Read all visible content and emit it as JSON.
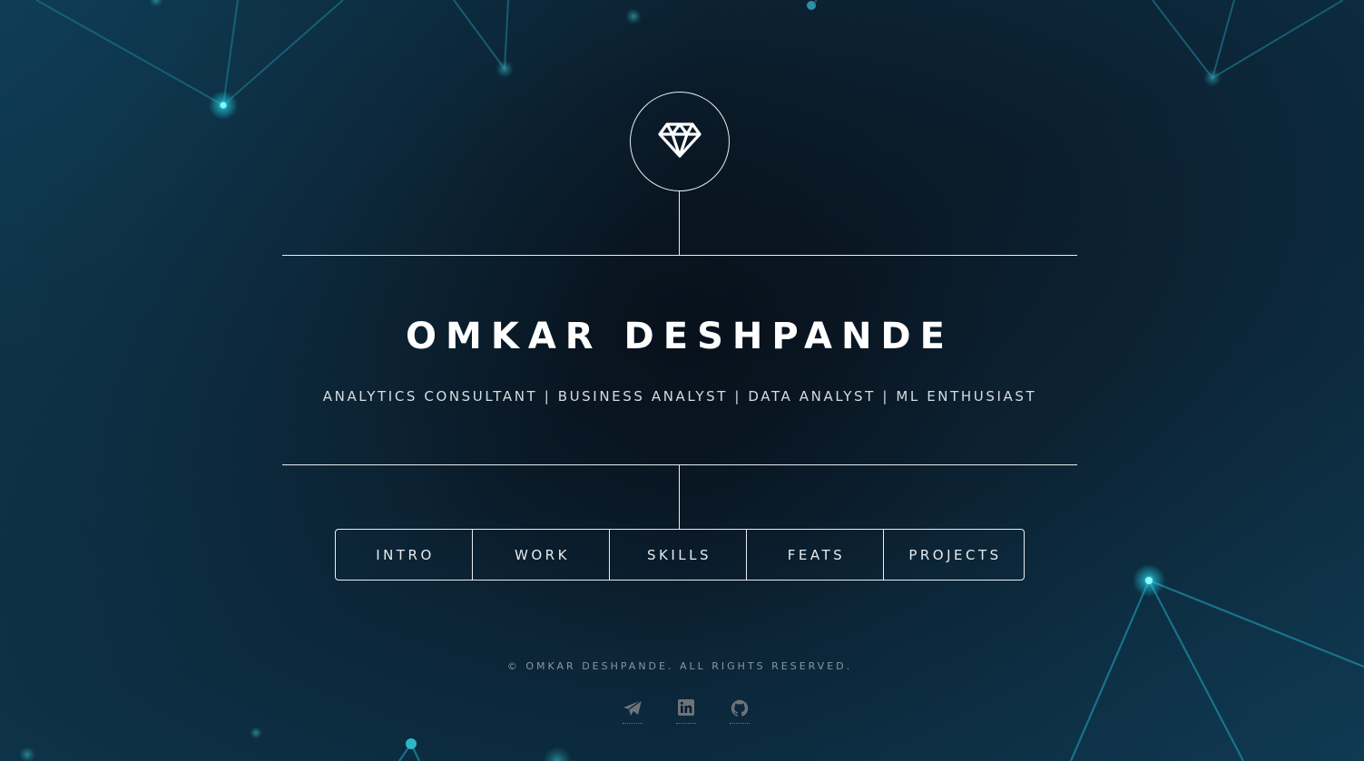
{
  "header": {
    "logo_icon": "diamond-icon",
    "name": "OMKAR DESHPANDE",
    "tagline": "ANALYTICS CONSULTANT | BUSINESS ANALYST | DATA ANALYST | ML ENTHUSIAST"
  },
  "nav": {
    "items": [
      {
        "label": "INTRO"
      },
      {
        "label": "WORK"
      },
      {
        "label": "SKILLS"
      },
      {
        "label": "FEATS"
      },
      {
        "label": "PROJECTS"
      }
    ]
  },
  "footer": {
    "copyright": "© OMKAR DESHPANDE. ALL RIGHTS RESERVED.",
    "social_icons": [
      "paper-plane-icon",
      "linkedin-icon",
      "github-icon"
    ]
  },
  "colors": {
    "background": "#0b1c2a",
    "line": "#e8eef2",
    "text": "#ffffff",
    "muted_text": "#8797a3",
    "accent_glow": "#1fc8d8"
  }
}
